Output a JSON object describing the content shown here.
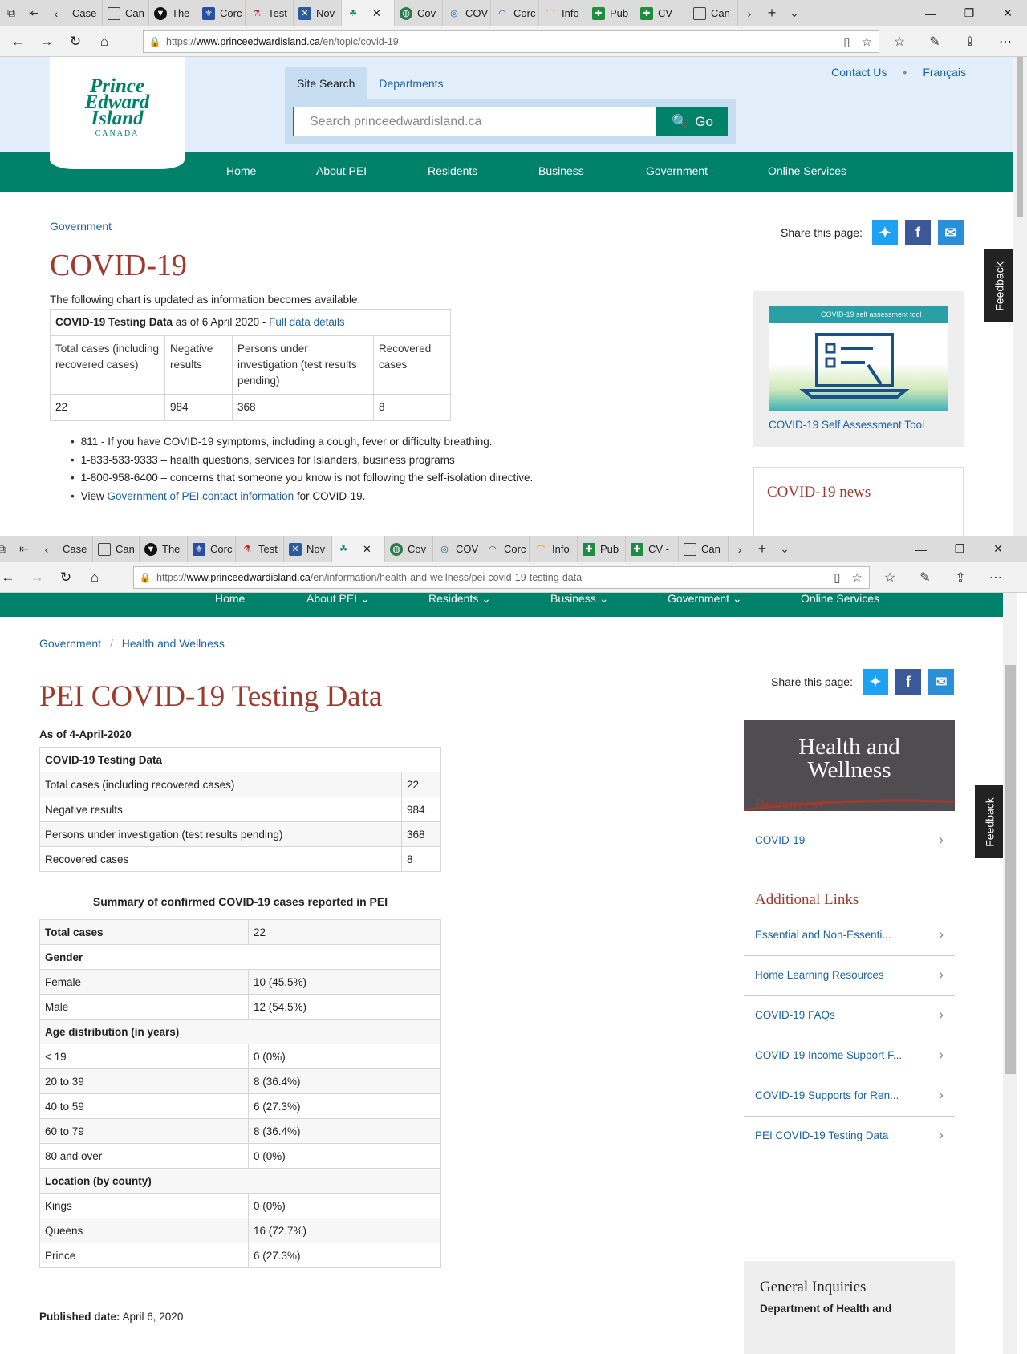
{
  "tabs": [
    "Case",
    "Can",
    "The",
    "Corc",
    "Test",
    "Nov",
    "",
    "Cov",
    "COV",
    "Corc",
    "Info",
    "Pub",
    "CV -",
    "Can"
  ],
  "window1": {
    "url_prefix": "https://",
    "url_domain": "www.princeedwardisland.ca",
    "url_path": "/en/topic/covid-19",
    "logo": {
      "line1": "Prince",
      "line2": "Edward",
      "line3": "Island",
      "line4": "CANADA"
    },
    "top_links": [
      "Contact Us",
      "Français"
    ],
    "search": {
      "tab_site": "Site Search",
      "tab_departments": "Departments",
      "placeholder": "Search princeedwardisland.ca",
      "go": "Go"
    },
    "nav": [
      "Home",
      "About PEI",
      "Residents",
      "Business",
      "Government",
      "Online Services"
    ],
    "breadcrumb": "Government",
    "share_label": "Share this page:",
    "title": "COVID-19",
    "intro": "The following chart is updated as information becomes available:",
    "table": {
      "caption_bold": "COVID-19 Testing Data",
      "caption_rest": " as of 6 April 2020 - ",
      "caption_link": "Full data details",
      "headers": [
        "Total cases (including recovered cases)",
        "Negative results",
        "Persons under investigation (test results pending)",
        "Recovered cases"
      ],
      "values": [
        "22",
        "984",
        "368",
        "8"
      ]
    },
    "bullets": [
      "811 - If you have COVID-19 symptoms, including a cough, fever or difficulty breathing.",
      "1-833-533-9333 – health questions, services for Islanders, business programs",
      "1-800-958-6400 – concerns that someone you know is not following the self-isolation directive."
    ],
    "bullet4_pre": "View ",
    "bullet4_link": "Government of PEI contact information",
    "bullet4_post": " for COVID-19.",
    "sa_banner": "COVID-19 self assessment tool",
    "sa_link": "COVID-19 Self Assessment Tool",
    "news": "COVID-19 news",
    "feedback": "Feedback"
  },
  "window2": {
    "url_prefix": "https://",
    "url_domain": "www.princeedwardisland.ca",
    "url_path": "/en/information/health-and-wellness/pei-covid-19-testing-data",
    "nav": [
      "Home",
      "About PEI",
      "Residents",
      "Business",
      "Government",
      "Online Services"
    ],
    "breadcrumb": [
      "Government",
      "Health and Wellness"
    ],
    "share_label": "Share this page:",
    "title": "PEI COVID-19 Testing Data",
    "as_of": "As of 4-April-2020",
    "testing_table": {
      "header": "COVID-19 Testing Data",
      "rows": [
        {
          "label": "Total cases (including recovered cases)",
          "value": "22"
        },
        {
          "label": "Negative results",
          "value": "984"
        },
        {
          "label": "Persons under investigation (test results pending)",
          "value": "368"
        },
        {
          "label": "Recovered cases",
          "value": "8"
        }
      ]
    },
    "summary_caption": "Summary of confirmed COVID-19 cases reported in PEI",
    "summary": {
      "total_label": "Total cases",
      "total_value": "22",
      "gender": "Gender",
      "female": "Female",
      "female_v": "10 (45.5%)",
      "male": "Male",
      "male_v": "12 (54.5%)",
      "age": "Age distribution (in years)",
      "a1": "< 19",
      "a1_v": "0 (0%)",
      "a2": "20 to 39",
      "a2_v": "8 (36.4%)",
      "a3": "40 to 59",
      "a3_v": "6 (27.3%)",
      "a4": "60 to 79",
      "a4_v": "8 (36.4%)",
      "a5": "80 and over",
      "a5_v": "0 (0%)",
      "location": "Location (by county)",
      "l1": "Kings",
      "l1_v": "0 (0%)",
      "l2": "Queens",
      "l2_v": "16 (72.7%)",
      "l3": "Prince",
      "l3_v": "6 (27.3%)"
    },
    "published_label": "Published date:",
    "published_value": " April 6, 2020",
    "hw_title_1": "Health and",
    "hw_title_2": "Wellness",
    "resources_head": "Resources",
    "resources": [
      "COVID-19"
    ],
    "additional_head": "Additional Links",
    "additional": [
      "Essential and Non-Essenti...",
      "Home Learning Resources",
      "COVID-19 FAQs",
      "COVID-19 Income Support F...",
      "COVID-19 Supports for Ren...",
      "PEI COVID-19 Testing Data"
    ],
    "gi_head": "General Inquiries",
    "gi_dept": "Department of Health and",
    "feedback": "Feedback"
  },
  "colors": {
    "green": "#00816a",
    "title_red": "#9f3a2f",
    "link_blue": "#1b62a8",
    "header_blue": "#e2eef9"
  }
}
